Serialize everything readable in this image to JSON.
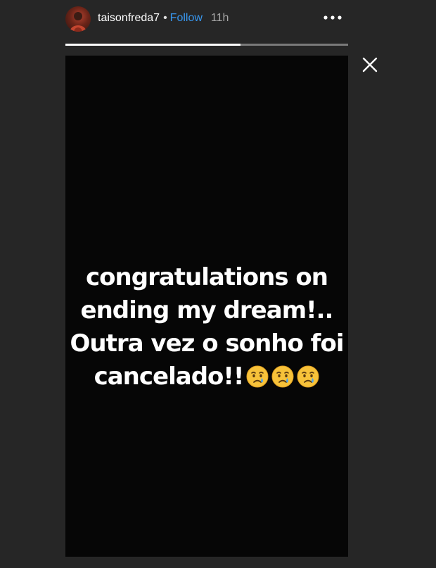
{
  "header": {
    "username": "taisonfreda7",
    "separator": "•",
    "follow_label": "Follow",
    "time_ago": "11h",
    "avatar_icon": "profile-photo",
    "more_icon": "more-dots-icon"
  },
  "progress": {
    "fraction": 0.62
  },
  "close_icon": "close-icon",
  "story": {
    "caption_lines": [
      "congratulations on",
      "ending my dream!..",
      "Outra vez o sonho foi",
      "cancelado!!"
    ],
    "emojis": [
      "crying-face",
      "crying-face",
      "crying-face"
    ]
  },
  "colors": {
    "page_background": "#262626",
    "story_background": "#060606",
    "follow_blue": "#3897f0",
    "emoji_yellow": "#f7c23a",
    "tear_blue": "#4fa3e8"
  }
}
